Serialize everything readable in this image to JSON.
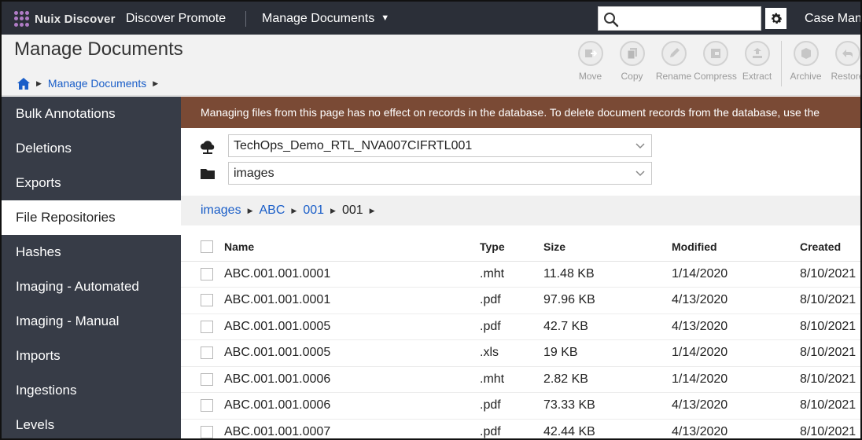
{
  "topbar": {
    "logo_text": "Nuix Discover",
    "nav_promote": "Discover Promote",
    "nav_manage": "Manage Documents",
    "case_link": "Case Mana"
  },
  "header": {
    "title": "Manage Documents",
    "breadcrumb": "Manage Documents"
  },
  "toolbar": [
    {
      "label": "Move",
      "icon": "move-icon"
    },
    {
      "label": "Copy",
      "icon": "copy-icon"
    },
    {
      "label": "Rename",
      "icon": "rename-icon"
    },
    {
      "label": "Compress",
      "icon": "compress-icon"
    },
    {
      "label": "Extract",
      "icon": "extract-icon"
    },
    {
      "label": "Archive",
      "icon": "archive-icon"
    },
    {
      "label": "Restore",
      "icon": "restore-icon"
    }
  ],
  "sidebar": {
    "items": [
      {
        "label": "Bulk Annotations",
        "active": false
      },
      {
        "label": "Deletions",
        "active": false
      },
      {
        "label": "Exports",
        "active": false
      },
      {
        "label": "File Repositories",
        "active": true
      },
      {
        "label": "Hashes",
        "active": false
      },
      {
        "label": "Imaging - Automated",
        "active": false
      },
      {
        "label": "Imaging - Manual",
        "active": false
      },
      {
        "label": "Imports",
        "active": false
      },
      {
        "label": "Ingestions",
        "active": false
      },
      {
        "label": "Levels",
        "active": false
      }
    ]
  },
  "main": {
    "banner": "Managing files from this page has no effect on records in the database. To delete document records from the database, use the",
    "repository": "TechOps_Demo_RTL_NVA007CIFRTL001",
    "folder": "images",
    "path": [
      "images",
      "ABC",
      "001"
    ],
    "path_current": "001"
  },
  "table": {
    "headers": {
      "name": "Name",
      "type": "Type",
      "size": "Size",
      "modified": "Modified",
      "created": "Created"
    },
    "rows": [
      {
        "name": "ABC.001.001.0001",
        "type": ".mht",
        "size": "11.48 KB",
        "modified": "1/14/2020",
        "created": "8/10/2021"
      },
      {
        "name": "ABC.001.001.0001",
        "type": ".pdf",
        "size": "97.96 KB",
        "modified": "4/13/2020",
        "created": "8/10/2021"
      },
      {
        "name": "ABC.001.001.0005",
        "type": ".pdf",
        "size": "42.7 KB",
        "modified": "4/13/2020",
        "created": "8/10/2021"
      },
      {
        "name": "ABC.001.001.0005",
        "type": ".xls",
        "size": "19 KB",
        "modified": "1/14/2020",
        "created": "8/10/2021"
      },
      {
        "name": "ABC.001.001.0006",
        "type": ".mht",
        "size": "2.82 KB",
        "modified": "1/14/2020",
        "created": "8/10/2021"
      },
      {
        "name": "ABC.001.001.0006",
        "type": ".pdf",
        "size": "73.33 KB",
        "modified": "4/13/2020",
        "created": "8/10/2021"
      },
      {
        "name": "ABC.001.001.0007",
        "type": ".pdf",
        "size": "42.44 KB",
        "modified": "4/13/2020",
        "created": "8/10/2021"
      }
    ]
  },
  "colors": {
    "topbar": "#2b2f38",
    "sidebar": "#373c47",
    "banner": "#7a4a35",
    "link": "#1a5ec8"
  }
}
